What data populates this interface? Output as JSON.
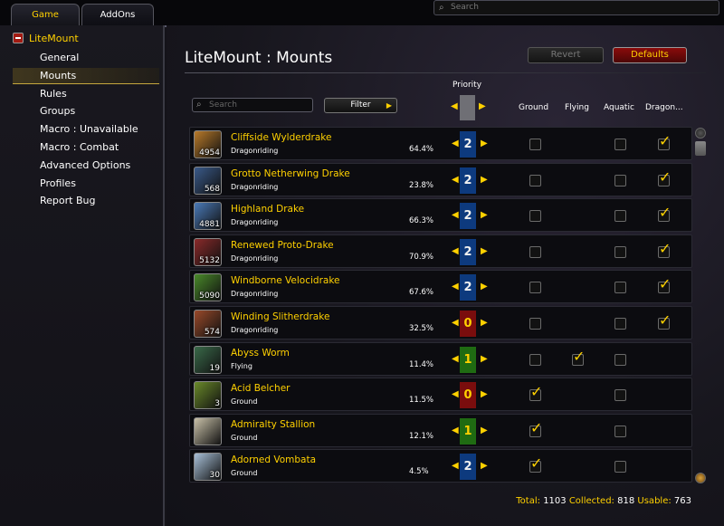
{
  "top_tabs": {
    "game": "Game",
    "addons": "AddOns"
  },
  "top_search": {
    "placeholder": "Search"
  },
  "sidebar": {
    "root": "LiteMount",
    "items": [
      {
        "label": "General"
      },
      {
        "label": "Mounts",
        "selected": true
      },
      {
        "label": "Rules"
      },
      {
        "label": "Groups"
      },
      {
        "label": "Macro : Unavailable"
      },
      {
        "label": "Macro : Combat"
      },
      {
        "label": "Advanced Options"
      },
      {
        "label": "Profiles"
      },
      {
        "label": "Report Bug"
      }
    ]
  },
  "main": {
    "title": "LiteMount : Mounts",
    "revert": "Revert",
    "defaults": "Defaults",
    "search_placeholder": "Search",
    "filter": "Filter",
    "columns": {
      "priority": "Priority",
      "ground": "Ground",
      "flying": "Flying",
      "aquatic": "Aquatic",
      "dragon": "Dragon..."
    }
  },
  "mounts": [
    {
      "name": "Cliffside Wylderdrake",
      "type": "Dragonriding",
      "count": "4954",
      "pct": "64.4%",
      "priority": "2",
      "ground": false,
      "flying": null,
      "aquatic": false,
      "dragon": true,
      "icon_color": "#b87a2a"
    },
    {
      "name": "Grotto Netherwing Drake",
      "type": "Dragonriding",
      "count": "568",
      "pct": "23.8%",
      "priority": "2",
      "ground": false,
      "flying": null,
      "aquatic": false,
      "dragon": true,
      "icon_color": "#3a5a8a"
    },
    {
      "name": "Highland Drake",
      "type": "Dragonriding",
      "count": "4881",
      "pct": "66.3%",
      "priority": "2",
      "ground": false,
      "flying": null,
      "aquatic": false,
      "dragon": true,
      "icon_color": "#4a7ab8"
    },
    {
      "name": "Renewed Proto-Drake",
      "type": "Dragonriding",
      "count": "5132",
      "pct": "70.9%",
      "priority": "2",
      "ground": false,
      "flying": null,
      "aquatic": false,
      "dragon": true,
      "icon_color": "#8a2a2a"
    },
    {
      "name": "Windborne Velocidrake",
      "type": "Dragonriding",
      "count": "5090",
      "pct": "67.6%",
      "priority": "2",
      "ground": false,
      "flying": null,
      "aquatic": false,
      "dragon": true,
      "icon_color": "#4a8a2a"
    },
    {
      "name": "Winding Slitherdrake",
      "type": "Dragonriding",
      "count": "574",
      "pct": "32.5%",
      "priority": "0",
      "ground": false,
      "flying": null,
      "aquatic": false,
      "dragon": true,
      "icon_color": "#9a4a2a"
    },
    {
      "name": "Abyss Worm",
      "type": "Flying",
      "count": "19",
      "pct": "11.4%",
      "priority": "1",
      "ground": false,
      "flying": true,
      "aquatic": false,
      "dragon": null,
      "icon_color": "#3a6a4a"
    },
    {
      "name": "Acid Belcher",
      "type": "Ground",
      "count": "3",
      "pct": "11.5%",
      "priority": "0",
      "ground": true,
      "flying": null,
      "aquatic": false,
      "dragon": null,
      "icon_color": "#6a8a2a"
    },
    {
      "name": "Admiralty Stallion",
      "type": "Ground",
      "count": "",
      "pct": "12.1%",
      "priority": "1",
      "ground": true,
      "flying": null,
      "aquatic": false,
      "dragon": null,
      "icon_color": "#c8c0a8"
    },
    {
      "name": "Adorned Vombata",
      "type": "Ground",
      "count": "30",
      "pct": "4.5%",
      "priority": "2",
      "ground": true,
      "flying": null,
      "aquatic": false,
      "dragon": null,
      "icon_color": "#a8c0d8"
    }
  ],
  "footer": {
    "total_label": "Total:",
    "total": "1103",
    "collected_label": "Collected:",
    "collected": "818",
    "usable_label": "Usable:",
    "usable": "763"
  }
}
